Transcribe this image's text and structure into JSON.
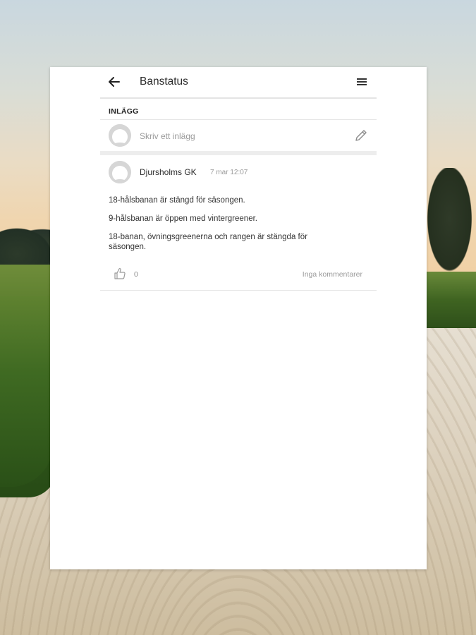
{
  "header": {
    "title": "Banstatus",
    "back_icon": "arrow-left-icon",
    "menu_icon": "hamburger-menu-icon"
  },
  "section": {
    "label": "INLÄGG"
  },
  "compose": {
    "placeholder": "Skriv ett inlägg",
    "edit_icon": "pencil-icon",
    "avatar_icon": "default-avatar-icon"
  },
  "post": {
    "author": "Djursholms GK",
    "timestamp": "7 mar 12:07",
    "paragraphs": [
      "18-hålsbanan är stängd för säsongen.",
      "9-hålsbanan är öppen med vintergreener.",
      "18-banan, övningsgreenerna och rangen är stängda för säsongen."
    ],
    "like_icon": "thumbs-up-icon",
    "like_count": "0",
    "comments_label": "Inga kommentarer"
  },
  "colors": {
    "card_bg": "#ffffff",
    "divider": "#e6e6e6",
    "muted_text": "#9a9a9a",
    "primary_text": "#2b2b2b"
  }
}
